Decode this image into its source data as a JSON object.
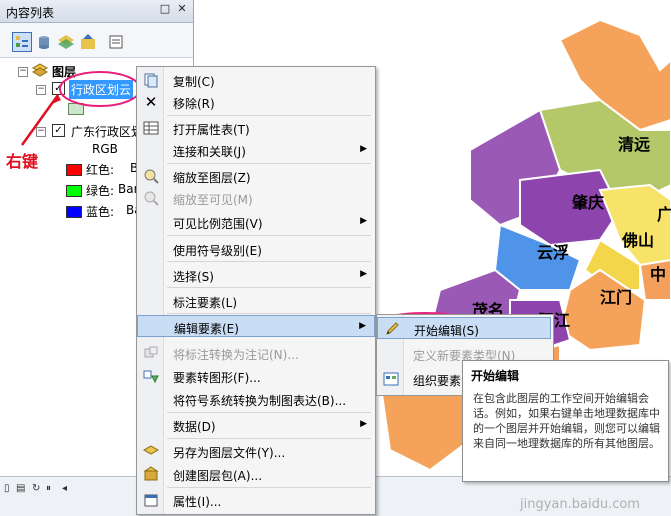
{
  "toc": {
    "title": "内容列表",
    "pin": "□",
    "close": "✕",
    "root_label": "图层",
    "layer1_label": "行政区划云",
    "layer2_label": "广东行政区划",
    "rgb_label": "RGB",
    "bands": [
      {
        "label": "红色:",
        "value": "B",
        "color": "#ff0000"
      },
      {
        "label": "绿色:",
        "value": "Ban",
        "color": "#00ff00"
      },
      {
        "label": "蓝色:",
        "value": "Ba",
        "color": "#0000ff"
      }
    ]
  },
  "annotation": {
    "right_click": "右键"
  },
  "context_menu": {
    "items": [
      {
        "label": "复制(C)",
        "icon": "copy-icon",
        "disabled": false,
        "submenu": false
      },
      {
        "label": "移除(R)",
        "icon": "remove-icon",
        "disabled": false,
        "submenu": false
      },
      {
        "label": "打开属性表(T)",
        "icon": "table-icon",
        "disabled": false,
        "submenu": false
      },
      {
        "label": "连接和关联(J)",
        "icon": "",
        "disabled": false,
        "submenu": true
      },
      {
        "label": "缩放至图层(Z)",
        "icon": "zoom-layer-icon",
        "disabled": false,
        "submenu": false
      },
      {
        "label": "缩放至可见(M)",
        "icon": "zoom-visible-icon",
        "disabled": true,
        "submenu": false
      },
      {
        "label": "可见比例范围(V)",
        "icon": "",
        "disabled": false,
        "submenu": true
      },
      {
        "label": "使用符号级别(E)",
        "icon": "",
        "disabled": false,
        "submenu": false
      },
      {
        "label": "选择(S)",
        "icon": "",
        "disabled": false,
        "submenu": true
      },
      {
        "label": "标注要素(L)",
        "icon": "",
        "disabled": false,
        "submenu": false
      },
      {
        "label": "编辑要素(E)",
        "icon": "",
        "disabled": false,
        "submenu": true
      },
      {
        "label": "将标注转换为注记(N)...",
        "icon": "convert-annotation-icon",
        "disabled": true,
        "submenu": false
      },
      {
        "label": "要素转图形(F)...",
        "icon": "feature-graphic-icon",
        "disabled": false,
        "submenu": false
      },
      {
        "label": "将符号系统转换为制图表达(B)...",
        "icon": "",
        "disabled": false,
        "submenu": false
      },
      {
        "label": "数据(D)",
        "icon": "",
        "disabled": false,
        "submenu": true
      },
      {
        "label": "另存为图层文件(Y)...",
        "icon": "save-layer-icon",
        "disabled": false,
        "submenu": false
      },
      {
        "label": "创建图层包(A)...",
        "icon": "layer-package-icon",
        "disabled": false,
        "submenu": false
      },
      {
        "label": "属性(I)...",
        "icon": "properties-icon",
        "disabled": false,
        "submenu": false
      }
    ]
  },
  "submenu": {
    "items": [
      {
        "label": "开始编辑(S)",
        "disabled": false
      },
      {
        "label": "定义新要素类型(N)",
        "disabled": true
      },
      {
        "label": "组织要素",
        "disabled": false
      }
    ]
  },
  "tooltip": {
    "title": "开始编辑",
    "body": "在包含此图层的工作空间开始编辑会话。例如，如果右键单击地理数据库中的一个图层并开始编辑，则您可以编辑来自同一地理数据库的所有其他图层。"
  },
  "map": {
    "cities": [
      "清远",
      "肇庆",
      "广",
      "云浮",
      "佛山",
      "中",
      "江门",
      "茂名",
      "阳江"
    ]
  },
  "watermark": "jingyan.baidu.com"
}
